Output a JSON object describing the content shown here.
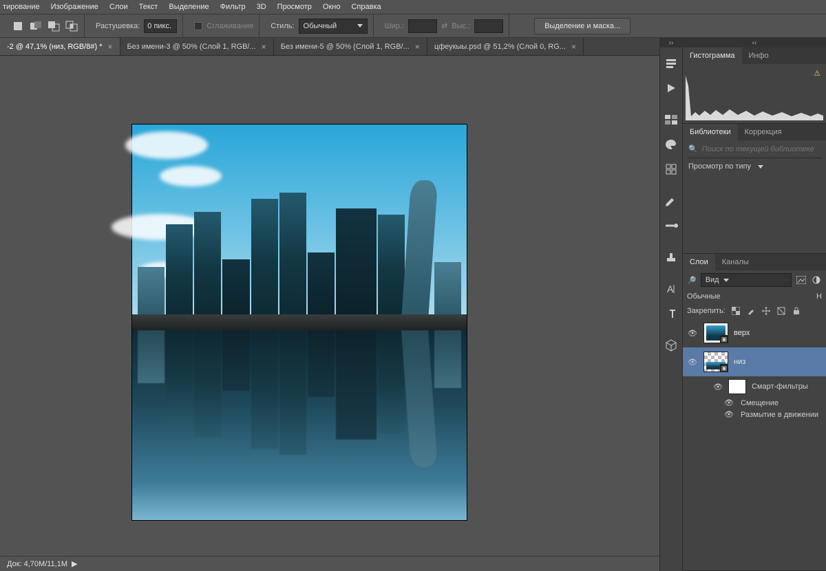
{
  "menu": {
    "items": [
      "тирование",
      "Изображение",
      "Слои",
      "Текст",
      "Выделение",
      "Фильтр",
      "3D",
      "Просмотр",
      "Окно",
      "Справка"
    ]
  },
  "options": {
    "feather_label": "Растушевка:",
    "feather_value": "0 пикс.",
    "antialias_label": "Сглаживание",
    "style_label": "Стиль:",
    "style_value": "Обычный",
    "width_label": "Шир.:",
    "height_label": "Выс.:",
    "select_and_mask": "Выделение и маска..."
  },
  "tabs": [
    {
      "label": "-2 @ 47,1% (низ, RGB/8#) *",
      "active": true
    },
    {
      "label": "Без имени-3 @ 50% (Слой 1, RGB/...",
      "active": false
    },
    {
      "label": "Без имени-5 @ 50% (Слой 1, RGB/...",
      "active": false
    },
    {
      "label": "цфеукыы.psd @ 51,2% (Слой 0, RG...",
      "active": false
    }
  ],
  "status": {
    "doc": "Док: 4,70M/11,1M"
  },
  "panelCollapse": "‹‹",
  "histogram": {
    "tab1": "Гистограмма",
    "tab2": "Инфо"
  },
  "libraries": {
    "tab1": "Библиотеки",
    "tab2": "Коррекция",
    "search_placeholder": "Поиск по текущей библиотеке",
    "view_label": "Просмотр по типу"
  },
  "layers": {
    "tab1": "Слои",
    "tab2": "Каналы",
    "kind_label": "Вид",
    "blend_label": "Обычные",
    "opacity_short": "Н",
    "lock_label": "Закрепить:",
    "layer_top": "верх",
    "layer_bottom": "низ",
    "smart_filters": "Смарт-фильтры",
    "filter_displace": "Смещение",
    "filter_motionblur": "Размытие в движении"
  }
}
